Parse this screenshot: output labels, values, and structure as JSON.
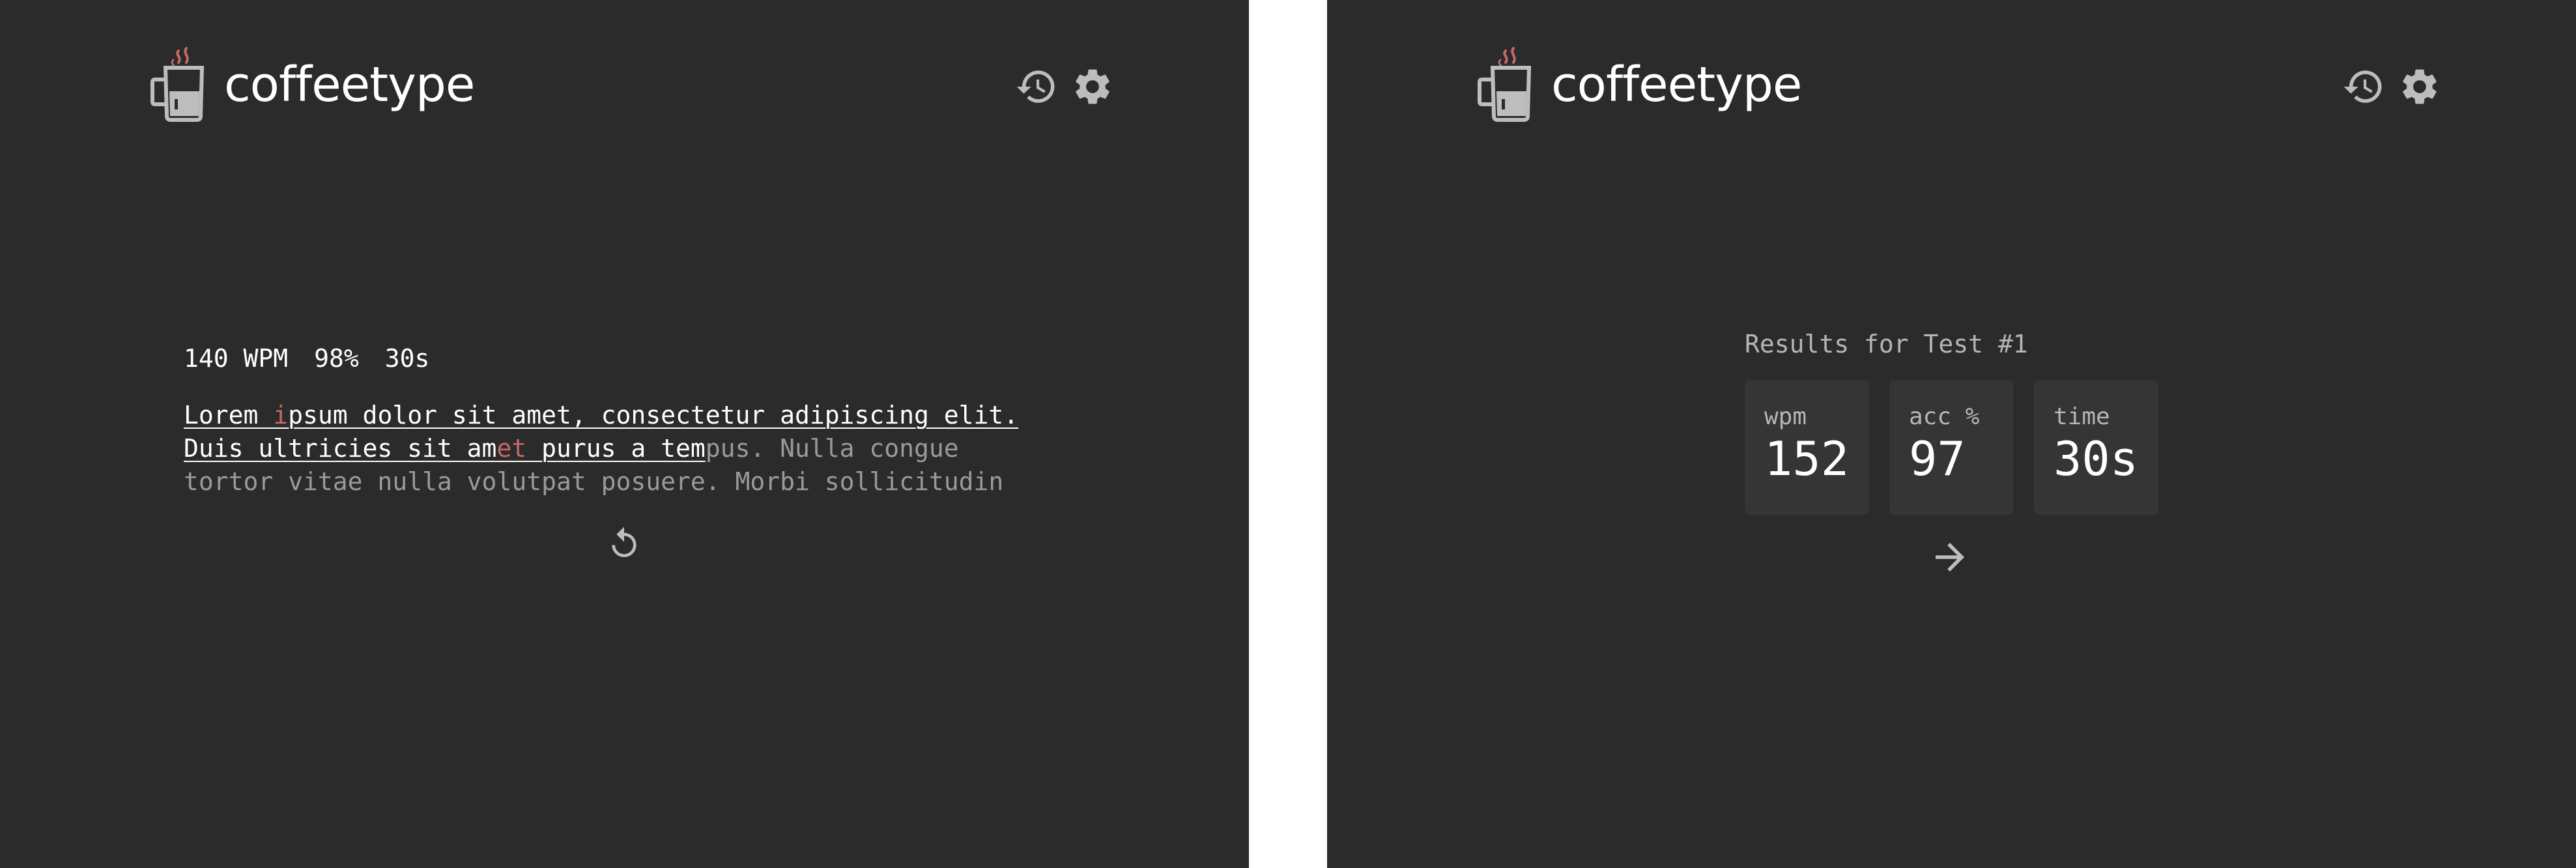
{
  "app": {
    "name": "coffeetype"
  },
  "icons": {
    "logo": "coffee-mug-icon",
    "history": "history-icon",
    "settings": "gear-icon",
    "restart": "restart-icon",
    "next": "arrow-right-icon"
  },
  "colors": {
    "background": "#2b2b2b",
    "text": "#ffffff",
    "muted": "#9a9a9a",
    "error": "#c46868",
    "card": "#353535"
  },
  "test": {
    "stats": {
      "wpm": "140 WPM",
      "accuracy": "98%",
      "time": "30s"
    },
    "lines": [
      {
        "segments": [
          {
            "text": "Lorem ",
            "state": "typed"
          },
          {
            "text": "i",
            "state": "error"
          },
          {
            "text": "psum dolor sit amet, consectetur adipiscing elit.",
            "state": "typed"
          }
        ]
      },
      {
        "segments": [
          {
            "text": "Duis ultricies sit am",
            "state": "typed"
          },
          {
            "text": "et ",
            "state": "error"
          },
          {
            "text": "purus a tem",
            "state": "typed"
          },
          {
            "text": "pus. Nulla congue",
            "state": "untyped"
          }
        ]
      },
      {
        "segments": [
          {
            "text": "tortor vitae nulla volutpat posuere. Morbi sollicitudin",
            "state": "untyped"
          }
        ]
      }
    ]
  },
  "results": {
    "title": "Results for Test #1",
    "cards": [
      {
        "label": "wpm",
        "value": "152"
      },
      {
        "label": "acc %",
        "value": "97"
      },
      {
        "label": "time",
        "value": "30s"
      }
    ]
  }
}
